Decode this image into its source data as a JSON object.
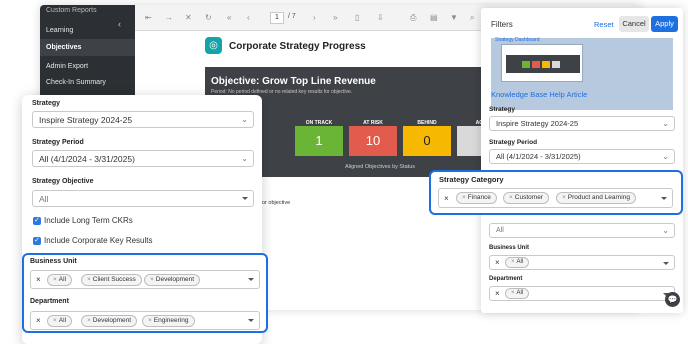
{
  "sidebar": {
    "top_item": "Custom Reports",
    "items": [
      "Learning",
      "Objectives",
      "Admin Export",
      "Check-In Summary"
    ]
  },
  "toolbar": {
    "page_current": "1",
    "page_total": "/ 7"
  },
  "report": {
    "title": "Corporate Strategy Progress",
    "objective_heading": "Objective: Grow Top Line Revenue",
    "objective_subtext": "Period: No period defined or no related key results for objective.",
    "status_caption": "Aligned Objectives by Status",
    "footer_text": "or objective",
    "statuses": [
      {
        "label": "ON TRACK",
        "value": "1",
        "color": "#6bb536"
      },
      {
        "label": "AT RISK",
        "value": "10",
        "color": "#e25b4c"
      },
      {
        "label": "BEHIND",
        "value": "0",
        "color": "#f6b800"
      },
      {
        "label": "ACH",
        "value": "",
        "color": "#d9d9d9"
      }
    ]
  },
  "left_filters": {
    "strategy_label": "Strategy",
    "strategy_value": "Inspire Strategy 2024-25",
    "period_label": "Strategy Period",
    "period_value": "All (4/1/2024 - 3/31/2025)",
    "objective_label": "Strategy Objective",
    "objective_value": "All",
    "checkboxes": [
      "Include Long Term CKRs",
      "Include Corporate Key Results"
    ],
    "business_unit_label": "Business Unit",
    "business_unit_tags": [
      "All",
      "Client Success",
      "Development"
    ],
    "department_label": "Department",
    "department_tags": [
      "All",
      "Development",
      "Engineering"
    ]
  },
  "right_panel": {
    "title": "Filters",
    "reset_label": "Reset",
    "cancel_label": "Cancel",
    "apply_label": "Apply",
    "thumb_caption_top": "Strategy Dashboard",
    "help_link": "Knowledge Base Help Article",
    "strategy_label": "Strategy",
    "strategy_value": "Inspire Strategy 2024-25",
    "period_label": "Strategy Period",
    "period_value": "All (4/1/2024 - 3/31/2025)",
    "category_label": "Strategy Category",
    "category_tags": [
      "Finance",
      "Customer",
      "Product and Learning"
    ],
    "objective_value": "All",
    "business_unit_label": "Business Unit",
    "business_unit_tags": [
      "All"
    ],
    "department_label": "Department",
    "department_tags": [
      "All"
    ]
  },
  "colors": {
    "accent": "#1e6fe0",
    "sidebar_bg": "#2c2f33",
    "report_panel": "#3e4146"
  }
}
